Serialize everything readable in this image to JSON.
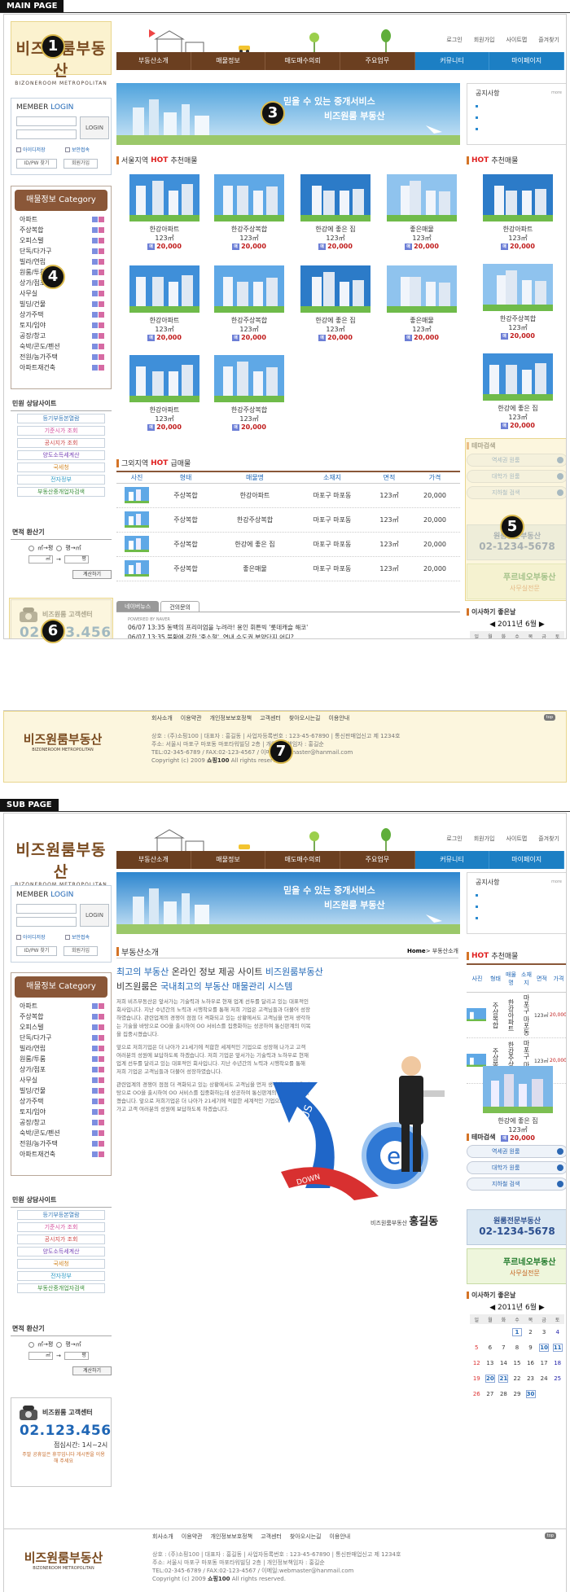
{
  "sections": {
    "main": "MAIN PAGE",
    "sub": "SUB PAGE"
  },
  "logo": {
    "name": "비즈원룸부동산",
    "eng": "BIZONEROOM METROPOLITAN"
  },
  "topnav": [
    "로그인",
    "회원가입",
    "사이트맵",
    "즐겨찾기"
  ],
  "mainnav": [
    "부동산소개",
    "매물정보",
    "매도매수의뢰",
    "주요업무",
    "커뮤니티",
    "마이페이지"
  ],
  "login": {
    "title_a": "MEMBER",
    "title_b": "LOGIN",
    "button": "LOGIN",
    "save_id": "아이디저장",
    "secure": "보안접속",
    "find": "ID/PW 찾기",
    "join": "회원가입"
  },
  "category": {
    "title": "매물정보 Category",
    "items": [
      "아파트",
      "주상복합",
      "오피스텔",
      "단독/다가구",
      "빌라/연립",
      "원룸/투룸",
      "상가/점포",
      "사무실",
      "빌딩/건물",
      "상가주택",
      "토지/임야",
      "공장/창고",
      "숙박/콘도/펜션",
      "전원/농가주택",
      "아파트재건축"
    ]
  },
  "consult": {
    "title_a": "민원",
    "title_b": "상담사이트",
    "items": [
      "등기부등본열람",
      "기준시가 조회",
      "공시지가 조회",
      "양도소득세계산",
      "국세청",
      "전자정부",
      "부동산중개업자검색"
    ]
  },
  "area": {
    "title_a": "면적",
    "title_b": "환산기",
    "opt1": "㎡→평",
    "opt2": "평→㎡",
    "unit1": "㎡",
    "arrow": "→",
    "unit2": "평",
    "calc": "계산하기"
  },
  "customer": {
    "title": "비즈원룸 고객센터",
    "phone": "02.123.4567",
    "hours": "점심시간: 1시~2시",
    "note": "주말 공휴일은 휴무입니다 게시판을 이용해 주세요"
  },
  "banner": {
    "line1": "믿을 수 있는 중개서비스",
    "line2": "비즈원룸 부동산"
  },
  "notice": {
    "title": "공지사항",
    "more": "more"
  },
  "seoul": {
    "title_a": "서울지역",
    "title_hot": "HOT",
    "title_b": "추천매물"
  },
  "listings": [
    {
      "name": "한강아파트",
      "area": "123㎡",
      "price": "20,000"
    },
    {
      "name": "한강주상복합",
      "area": "123㎡",
      "price": "20,000"
    },
    {
      "name": "한강에 좋은 집",
      "area": "123㎡",
      "price": "20,000"
    },
    {
      "name": "좋은매물",
      "area": "123㎡",
      "price": "20,000"
    },
    {
      "name": "한강아파트",
      "area": "123㎡",
      "price": "20,000"
    },
    {
      "name": "한강주상복합",
      "area": "123㎡",
      "price": "20,000"
    },
    {
      "name": "한강에 좋은 집",
      "area": "123㎡",
      "price": "20,000"
    },
    {
      "name": "좋은매물",
      "area": "123㎡",
      "price": "20,000"
    },
    {
      "name": "한강아파트",
      "area": "123㎡",
      "price": "20,000"
    },
    {
      "name": "한강주상복합",
      "area": "123㎡",
      "price": "20,000"
    }
  ],
  "hot": {
    "title_a": "HOT",
    "title_b": "추천매물",
    "items": [
      {
        "name": "한강아파트",
        "area": "123㎡",
        "price": "20,000"
      },
      {
        "name": "한강주상복합",
        "area": "123㎡",
        "price": "20,000"
      },
      {
        "name": "한강에 좋은 집",
        "area": "123㎡",
        "price": "20,000"
      }
    ]
  },
  "other": {
    "title_a": "그외지역",
    "title_hot": "HOT",
    "title_b": "급매물",
    "cols": [
      "사진",
      "형태",
      "매물명",
      "소재지",
      "면적",
      "가격"
    ],
    "rows": [
      {
        "type": "주상복합",
        "name": "한강아파트",
        "loc": "마포구 마포동",
        "area": "123㎡",
        "price": "20,000"
      },
      {
        "type": "주상복합",
        "name": "한강주상복합",
        "loc": "마포구 마포동",
        "area": "123㎡",
        "price": "20,000"
      },
      {
        "type": "주상복합",
        "name": "한강에 좋은 집",
        "loc": "마포구 마포동",
        "area": "123㎡",
        "price": "20,000"
      },
      {
        "type": "주상복합",
        "name": "좋은매물",
        "loc": "마포구 마포동",
        "area": "123㎡",
        "price": "20,000"
      }
    ]
  },
  "news": {
    "tab1": "네이버뉴스",
    "tab2": "건의문의",
    "powered": "POWERED BY NAVER",
    "items": [
      "06/07 13:35 동백의 프리미엄을 누려라! 용인 휘튼빅 '롯데캐슬 해코'",
      "06/07 13:35 불황에 강한 '중소형', 연내 수도권 분양단지 어디?",
      "06/07 13:32 중국, 부강성 주택건설 진도율 30%선",
      "06/07 13:30 하우스푸어 시대, 신용위험과 직결되는 연체 방지하기"
    ]
  },
  "theme": {
    "title": "테마검색",
    "items": [
      "역세권 원룸",
      "대학가 원룸",
      "지하철 검색"
    ]
  },
  "ad1": {
    "a": "원룸전문부동산",
    "b": "02-1234-5678"
  },
  "ad2": {
    "a": "푸르네오부동산",
    "b": "사무실전문"
  },
  "calendar": {
    "title": "이사하기 좋은날",
    "ym": "◀ 2011년 6월 ▶",
    "days": [
      "일",
      "월",
      "화",
      "수",
      "목",
      "금",
      "토"
    ],
    "weeks": [
      [
        "",
        "",
        "",
        "1",
        "2",
        "3",
        "4"
      ],
      [
        "5",
        "6",
        "7",
        "8",
        "9",
        "10",
        "11"
      ],
      [
        "12",
        "13",
        "14",
        "15",
        "16",
        "17",
        "18"
      ],
      [
        "19",
        "20",
        "21",
        "22",
        "23",
        "24",
        "25"
      ],
      [
        "26",
        "27",
        "28",
        "29",
        "30",
        "",
        ""
      ]
    ],
    "marked": [
      "1",
      "10",
      "11",
      "20",
      "21",
      "30"
    ]
  },
  "footer": {
    "links": [
      "회사소개",
      "이용약관",
      "개인정보보호정책",
      "고객센터",
      "찾아오시는길",
      "이용안내"
    ],
    "l1": "상호 : (주)소핑100 | 대표자 : 홍길동 | 사업자등록번호 : 123-45-67890 | 통신판매업신고 제 1234호",
    "l2": "주소: 서울시 마포구 마포동 마포타워빌딩 2층 | 개인정보책임자 : 홍길순",
    "l3": "TEL:02-345-6789 / FAX:02-123-4567 / 이메일:webmaster@hanmail.com",
    "l4": "Copyright (c) 2009",
    "l4b": "쇼핑100",
    "l4c": "All rights reserved.",
    "top": "top"
  },
  "markers": [
    "1",
    "2",
    "3",
    "4",
    "5",
    "6",
    "7"
  ],
  "sub": {
    "title": "부동산소개",
    "crumb_home": "Home",
    "crumb_sep": ">",
    "crumb_cur": "부동산소개",
    "l1a": "최고의 부동산",
    "l1b": "온라인 정보 제공 사이트",
    "l1c": "비즈원룸부동산",
    "l2a": "비즈원룸은",
    "l2b": "국내최고의 부동산 매물관리 시스템",
    "p1": "저희 비즈부동산은 앞서가는 기술력과 노하우로 현재 업계 선두를 달리고 있는 대표적인 회사입니다. 지난 수년간의 노력과 시행착오를 통해 저희 기업은 고객님들과 더불어 성장하였습니다. 관련업계의 경쟁이 점점 더 격화되고 있는 상황에서도 고객님을 먼저 생각하는 기술을 바탕으로 OO을 출시하여 OO 서비스를 집중화하는 성공하여 통신판계의 이목을 집중시켰습니다.",
    "p2": "앞으로 저희기업은 더 나아가 21세기에 적합한 세계적인 기업으로 성장해 나가고 고객 여러분의 성원에 보답하도록 하겠습니다. 저희 기업은 앞서가는 기술력과 노하우로 현재 업계 선두를 달리고 있는 대표적인 회사입니다. 지난 수년간의 노력과 시행착오를 통해 저희 기업은 고객님들과 더불어 성장하였습니다.",
    "p3": "관련업계의 경쟁이 점점 더 격화되고 있는 상황에서도 고객님을 먼저 생각하는 기술을 바탕으로 OO을 출시하여 OO 서비스를 집중화하는데 성공하여 통신판계의 이목을 집중시켰습니다. 앞으로 저희기업은 더 나아가 21세기에 적합한 세계적인 기업으로 성장해 나가고 고객 여러분의 성원에 보답하도록 하겠습니다.",
    "sig_a": "비즈원룸부동산",
    "sig_b": "홍길동",
    "plus": "PLUS",
    "down": "DOWN",
    "e": "e",
    "hot_cols": [
      "사진",
      "형태",
      "매물명",
      "소재지",
      "면적",
      "가격"
    ],
    "hot_rows": [
      {
        "type": "주상복합",
        "name": "한강아파트",
        "loc": "마포구 마포동",
        "area": "123㎡",
        "price": "20,000"
      },
      {
        "type": "주상복합",
        "name": "한강주상복합",
        "loc": "마포구 마포동",
        "area": "123㎡",
        "price": "20,000"
      }
    ],
    "hot_item": {
      "name": "한강에 좋은 집",
      "area": "123㎡",
      "price": "20,000"
    }
  }
}
